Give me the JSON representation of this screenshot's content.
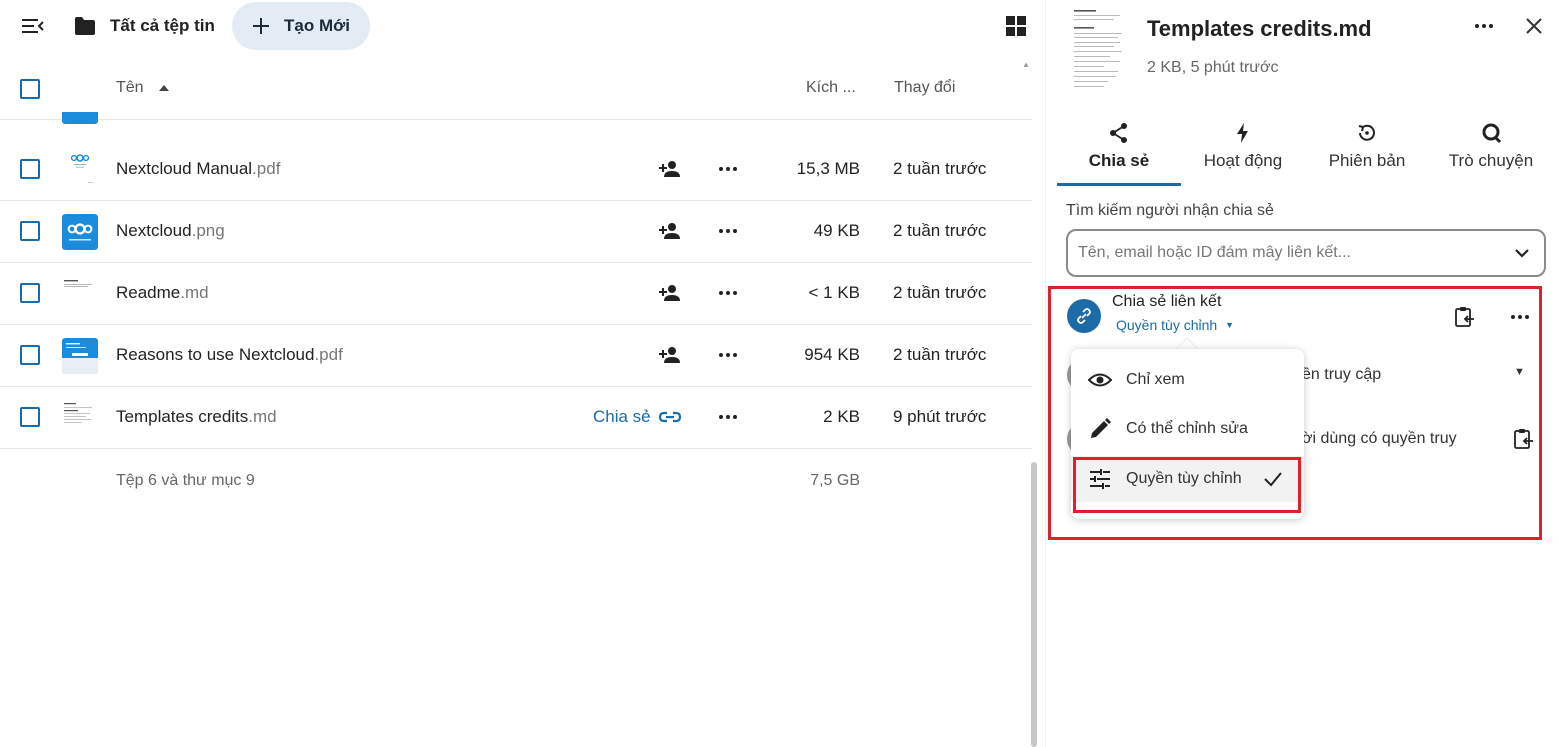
{
  "topbar": {
    "breadcrumb_label": "Tất cả tệp tin",
    "new_button_label": "Tạo Mới"
  },
  "list_header": {
    "name": "Tên",
    "size": "Kích ...",
    "modified": "Thay đổi"
  },
  "files": [
    {
      "base": "Nextcloud Manual",
      "ext": ".pdf",
      "size": "15,3 MB",
      "modified": "2 tuần trước",
      "shared_label": ""
    },
    {
      "base": "Nextcloud",
      "ext": ".png",
      "size": "49 KB",
      "modified": "2 tuần trước",
      "shared_label": ""
    },
    {
      "base": "Readme",
      "ext": ".md",
      "size": "< 1 KB",
      "modified": "2 tuần trước",
      "shared_label": ""
    },
    {
      "base": "Reasons to use Nextcloud",
      "ext": ".pdf",
      "size": "954 KB",
      "modified": "2 tuần trước",
      "shared_label": ""
    },
    {
      "base": "Templates credits",
      "ext": ".md",
      "size": "2 KB",
      "modified": "9 phút trước",
      "shared_label": "Chia sẻ"
    }
  ],
  "summary": {
    "counts": "Tệp 6 và thư mục 9",
    "total_size": "7,5 GB"
  },
  "sidebar": {
    "title": "Templates credits.md",
    "subtitle": "2 KB, 5 phút trước",
    "tabs": [
      {
        "label": "Chia sẻ",
        "icon": "share-icon",
        "active": true
      },
      {
        "label": "Hoạt động",
        "icon": "lightning-icon",
        "active": false
      },
      {
        "label": "Phiên bản",
        "icon": "history-icon",
        "active": false
      },
      {
        "label": "Trò chuyện",
        "icon": "talk-icon",
        "active": false
      }
    ],
    "search_label": "Tìm kiếm người nhận chia sẻ",
    "search_placeholder": "Tên, email hoặc ID đám mây liên kết...",
    "link_share": {
      "title": "Chia sẻ liên kết",
      "permission": "Quyền tùy chỉnh"
    },
    "background_text_1": "ền truy cập",
    "background_text_2": "ời dùng có quyền truy",
    "permission_menu": [
      {
        "label": "Chỉ xem",
        "icon": "eye-icon",
        "selected": false
      },
      {
        "label": "Có thể chỉnh sửa",
        "icon": "pencil-icon",
        "selected": false
      },
      {
        "label": "Quyền tùy chỉnh",
        "icon": "tune-icon",
        "selected": true
      }
    ]
  },
  "colors": {
    "primary": "#1d6aa8",
    "highlight": "#e0202a",
    "new_button_bg": "#e3ecf5"
  }
}
